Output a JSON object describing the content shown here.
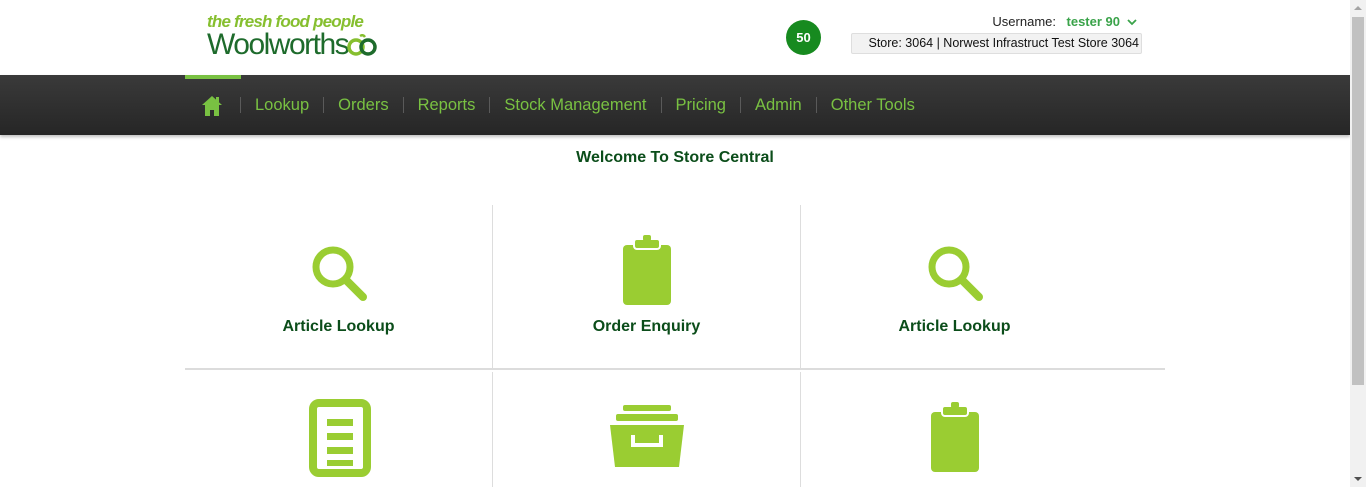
{
  "header": {
    "tagline": "the fresh food people",
    "brand": "Woolworths",
    "notification_count": "50",
    "username_label": "Username:",
    "username_value": "tester 90",
    "store_info": "Store: 3064 | Norwest Infrastruct Test Store 3064"
  },
  "nav": {
    "home_icon": "home-icon",
    "items": [
      {
        "label": "Lookup"
      },
      {
        "label": "Orders"
      },
      {
        "label": "Reports"
      },
      {
        "label": "Stock Management"
      },
      {
        "label": "Pricing"
      },
      {
        "label": "Admin"
      },
      {
        "label": "Other Tools"
      }
    ]
  },
  "main": {
    "welcome": "Welcome To Store Central",
    "tiles": [
      {
        "label": "Article Lookup",
        "icon": "search-icon"
      },
      {
        "label": "Order Enquiry",
        "icon": "clipboard-icon"
      },
      {
        "label": "Article Lookup",
        "icon": "search-icon"
      },
      {
        "label": "",
        "icon": "document-list-icon"
      },
      {
        "label": "",
        "icon": "archive-box-icon"
      },
      {
        "label": "",
        "icon": "clipboard-icon"
      }
    ]
  },
  "colors": {
    "accent_green": "#9acd32",
    "brand_dark_green": "#0b4d1a",
    "nav_text_green": "#79c142",
    "badge_green": "#178a1f",
    "nav_background": "#2e2e2e"
  }
}
